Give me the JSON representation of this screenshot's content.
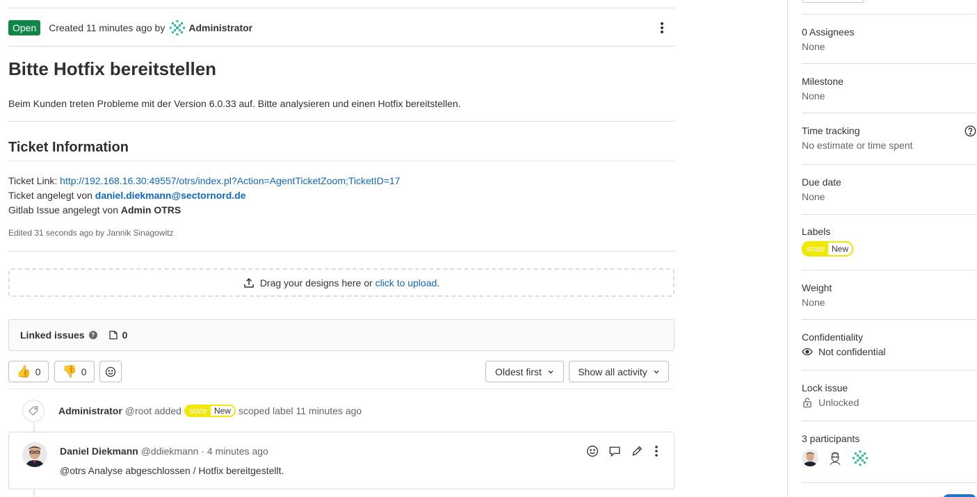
{
  "issue": {
    "status": "Open",
    "created_text": "Created 11 minutes ago by",
    "author": "Administrator",
    "title": "Bitte Hotfix bereitstellen",
    "description": "Beim Kunden treten Probleme mit der Version 6.0.33 auf. Bitte analysieren und einen Hotfix bereitstellen.",
    "section_heading": "Ticket Information",
    "ticket_link_label": "Ticket Link: ",
    "ticket_link_url": "http://192.168.16.30:49557/otrs/index.pl?Action=AgentTicketZoom;TicketID=17",
    "created_by_label": "Ticket angelegt von ",
    "created_by_email": "daniel.diekmann@sectornord.de",
    "gitlab_label": "Gitlab Issue angelegt von ",
    "gitlab_user": "Admin OTRS",
    "edited": "Edited 31 seconds ago by Jannik Sinagowitz"
  },
  "upload": {
    "text": "Drag your designs here or ",
    "link": "click to upload",
    "suffix": "."
  },
  "linked": {
    "label": "Linked issues",
    "count": "0"
  },
  "reactions": {
    "thumbs_up": "0",
    "thumbs_down": "0"
  },
  "sort": {
    "order": "Oldest first",
    "filter": "Show all activity"
  },
  "activity": {
    "user": "Administrator",
    "handle": "@root added",
    "label_key": "state",
    "label_value": "New",
    "suffix": "scoped label 11 minutes ago"
  },
  "comment": {
    "name": "Daniel Diekmann",
    "meta": "@ddiekmann · 4 minutes ago",
    "body": "@otrs Analyse abgeschlossen / Hotfix bereitgestellt."
  },
  "sidebar": {
    "assignees_title": "0 Assignees",
    "assignees_value": "None",
    "milestone_title": "Milestone",
    "milestone_value": "None",
    "time_title": "Time tracking",
    "time_value": "No estimate or time spent",
    "due_title": "Due date",
    "due_value": "None",
    "labels_title": "Labels",
    "label_key": "state",
    "label_value": "New",
    "weight_title": "Weight",
    "weight_value": "None",
    "conf_title": "Confidentiality",
    "conf_value": "Not confidential",
    "lock_title": "Lock issue",
    "lock_value": "Unlocked",
    "participants_title": "3 participants"
  },
  "colors": {
    "open_badge": "#108548",
    "link": "#1068bf",
    "scoped_label": "#f0e800"
  }
}
